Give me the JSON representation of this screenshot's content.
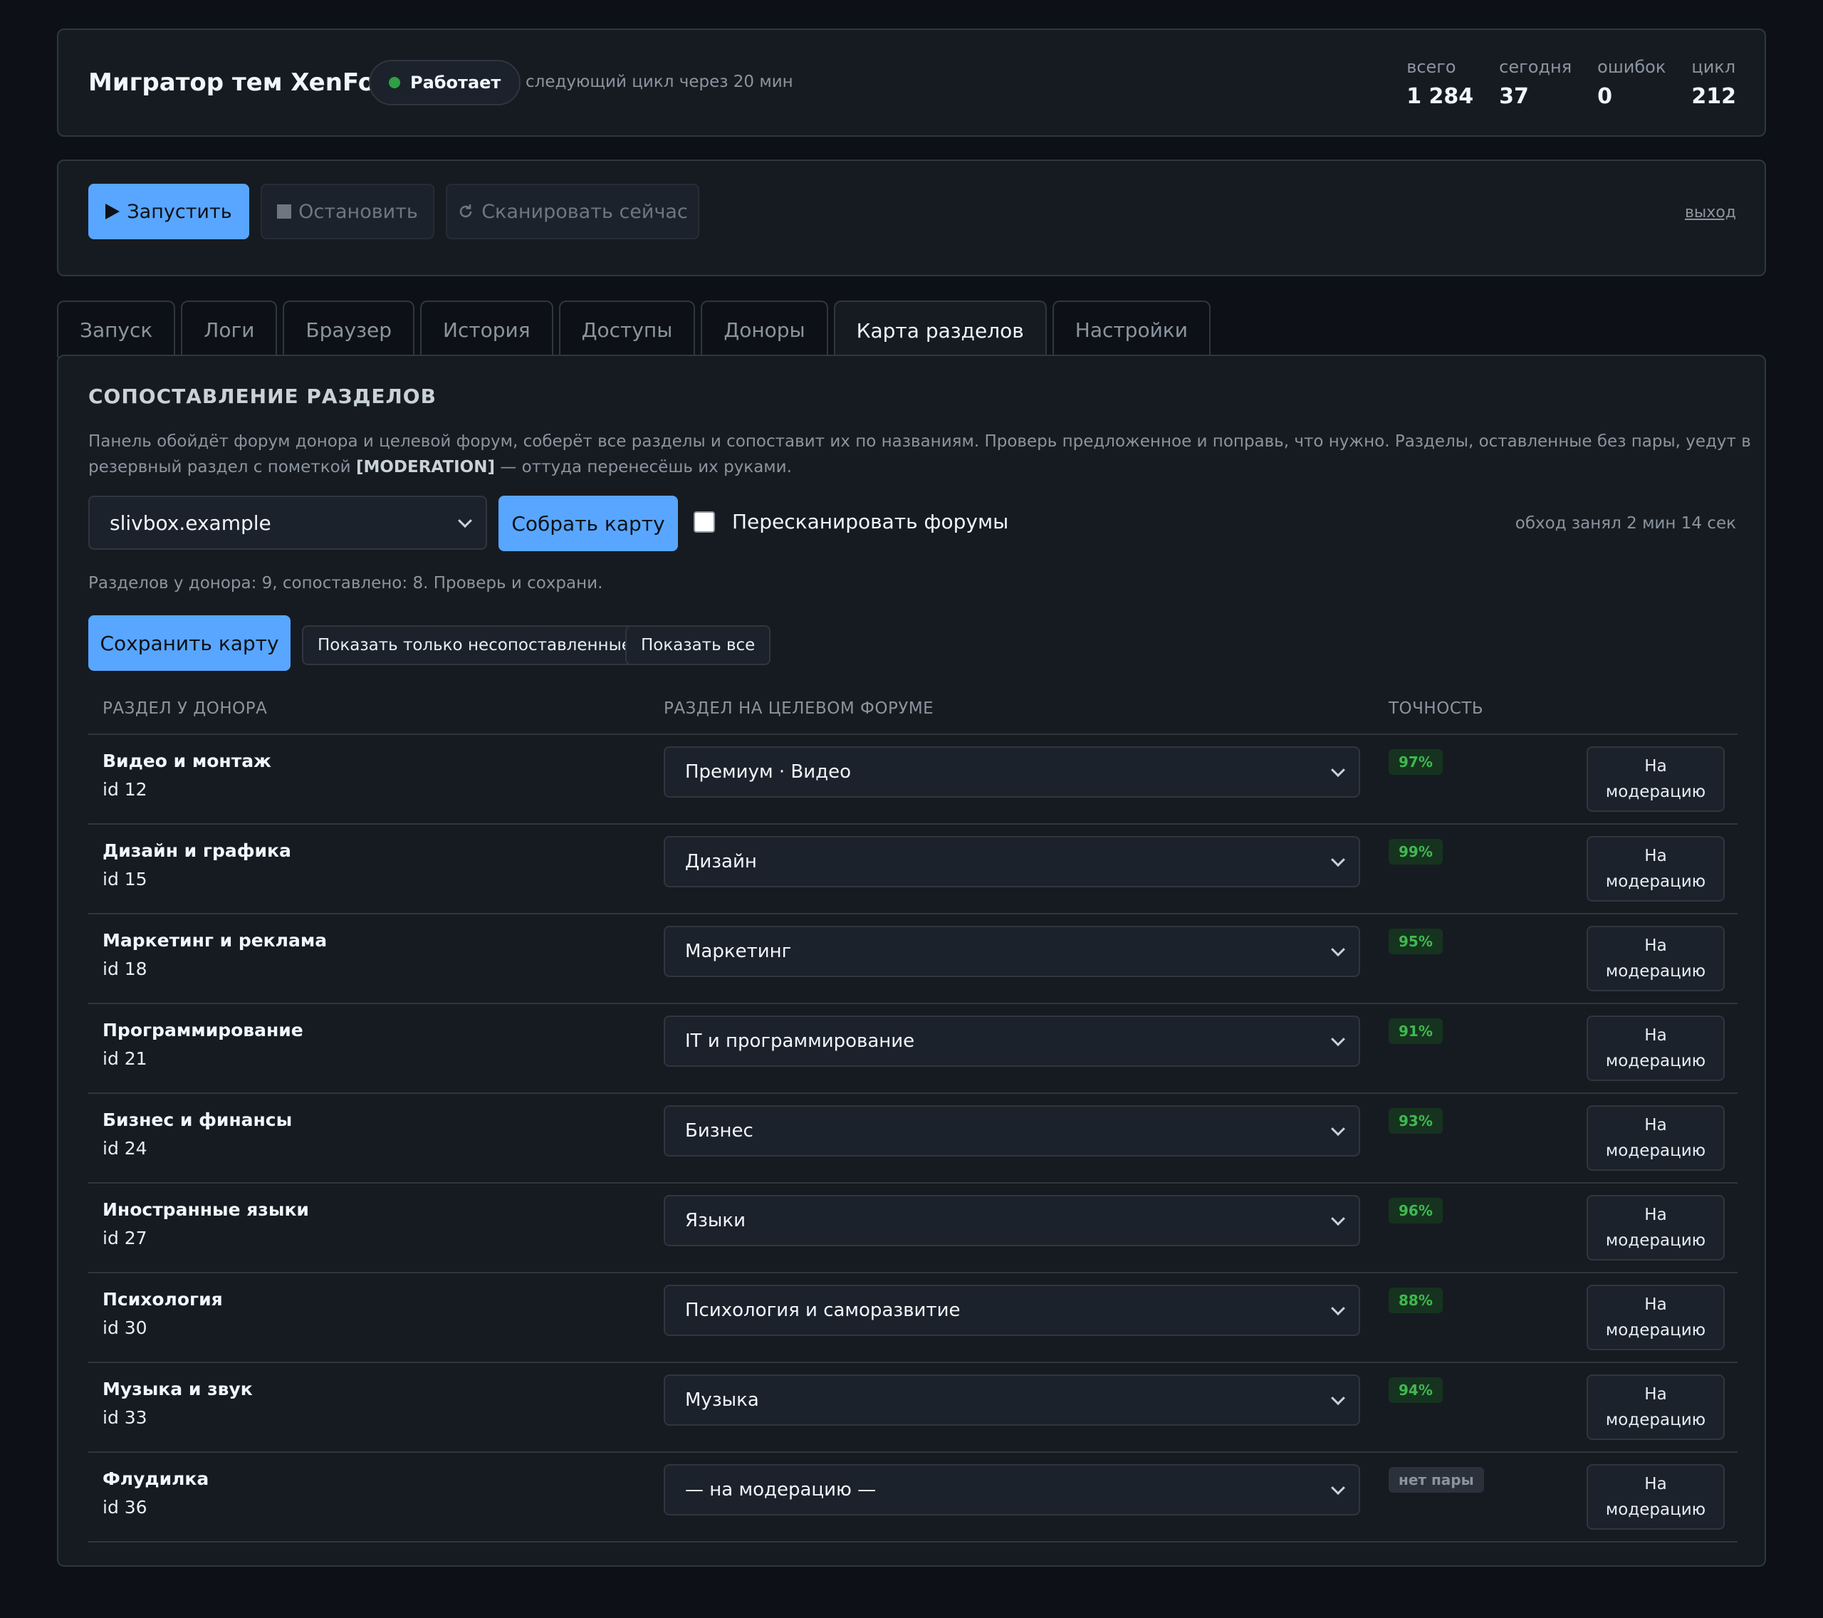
{
  "header": {
    "title": "Мигратор тем XenForo",
    "status": "Работает",
    "next_cycle": "следующий цикл через 20 мин",
    "stats": [
      {
        "label": "всего",
        "value": "1 284"
      },
      {
        "label": "сегодня",
        "value": "37"
      },
      {
        "label": "ошибок",
        "value": "0"
      },
      {
        "label": "цикл",
        "value": "212"
      }
    ],
    "colors": {
      "status_dot": "#2ea043",
      "accent": "#58a6ff"
    }
  },
  "toolbar": {
    "run_label": "Запустить",
    "stop_label": "Остановить",
    "scan_label": "Сканировать сейчас",
    "logout_label": "выход",
    "icons": {
      "run": "play-icon",
      "stop": "stop-icon",
      "scan": "refresh-icon"
    }
  },
  "tabs": [
    {
      "label": "Запуск",
      "active": false
    },
    {
      "label": "Логи",
      "active": false
    },
    {
      "label": "Браузер",
      "active": false
    },
    {
      "label": "История",
      "active": false
    },
    {
      "label": "Доступы",
      "active": false
    },
    {
      "label": "Доноры",
      "active": false
    },
    {
      "label": "Карта разделов",
      "active": true
    },
    {
      "label": "Настройки",
      "active": false
    }
  ],
  "mapping": {
    "title": "СОПОСТАВЛЕНИЕ РАЗДЕЛОВ",
    "description_line1": "Панель обойдёт форум донора и целевой форум, соберёт все разделы и сопоставит их по названиям. Проверь предложенное и поправь, что нужно. Разделы, оставленные без пары, уедут в резервный",
    "description_prefix": "раздел с пометкой ",
    "description_tag": "[MODERATION]",
    "description_suffix": " — оттуда перенесёшь их руками.",
    "donor_selected": "slivbox.example",
    "build_label": "Собрать карту",
    "rescan_label": "Пересканировать форумы",
    "rescan_checked": false,
    "scan_time": "обход занял 2 мин 14 сек",
    "summary": "Разделов у донора: 9, сопоставлено: 8. Проверь и сохрани.",
    "save_label": "Сохранить карту",
    "show_unmatched_label": "Показать только несопоставленные",
    "show_all_label": "Показать все",
    "columns": {
      "donor": "РАЗДЕЛ У ДОНОРА",
      "target": "РАЗДЕЛ НА ЦЕЛЕВОМ ФОРУМЕ",
      "accuracy": "ТОЧНОСТЬ"
    },
    "moderation_button": "На модерацию",
    "rows": [
      {
        "name": "Видео и монтаж",
        "id": "id 12",
        "target": "Премиум · Видео",
        "accuracy": "97%",
        "matched": true
      },
      {
        "name": "Дизайн и графика",
        "id": "id 15",
        "target": "Дизайн",
        "accuracy": "99%",
        "matched": true
      },
      {
        "name": "Маркетинг и реклама",
        "id": "id 18",
        "target": "Маркетинг",
        "accuracy": "95%",
        "matched": true
      },
      {
        "name": "Программирование",
        "id": "id 21",
        "target": "IT и программирование",
        "accuracy": "91%",
        "matched": true
      },
      {
        "name": "Бизнес и финансы",
        "id": "id 24",
        "target": "Бизнес",
        "accuracy": "93%",
        "matched": true
      },
      {
        "name": "Иностранные языки",
        "id": "id 27",
        "target": "Языки",
        "accuracy": "96%",
        "matched": true
      },
      {
        "name": "Психология",
        "id": "id 30",
        "target": "Психология и саморазвитие",
        "accuracy": "88%",
        "matched": true
      },
      {
        "name": "Музыка и звук",
        "id": "id 33",
        "target": "Музыка",
        "accuracy": "94%",
        "matched": true
      },
      {
        "name": "Флудилка",
        "id": "id 36",
        "target": "— на модерацию —",
        "accuracy": "нет пары",
        "matched": false
      }
    ]
  }
}
